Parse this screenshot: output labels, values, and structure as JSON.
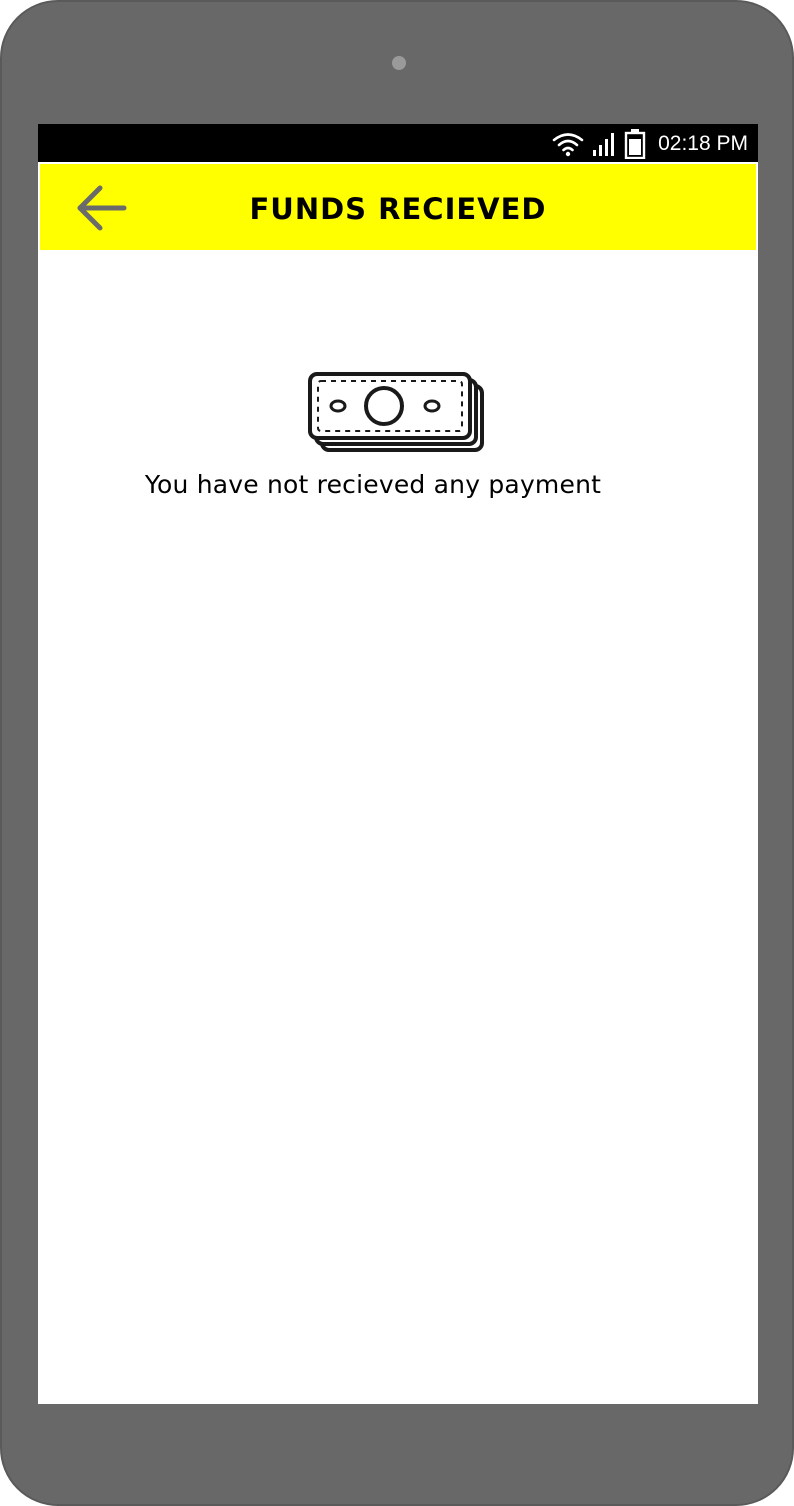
{
  "status_bar": {
    "time": "02:18 PM",
    "icons": [
      "wifi-icon",
      "signal-icon",
      "battery-icon"
    ]
  },
  "app_bar": {
    "title": "FUNDS RECIEVED",
    "back_icon": "arrow-left-icon",
    "background_color": "#ffff00"
  },
  "empty_state": {
    "icon": "money-stack-icon",
    "message": "You have not recieved any payment"
  }
}
